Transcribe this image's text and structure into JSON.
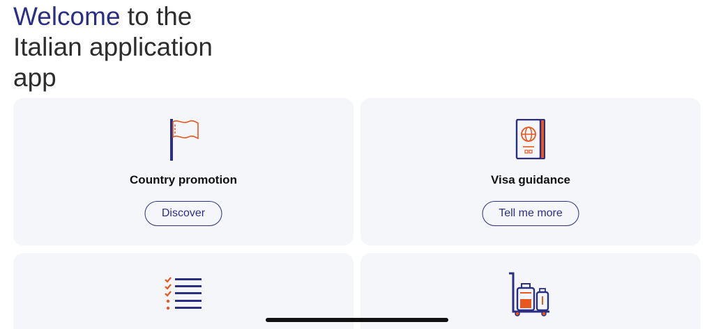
{
  "header": {
    "title_accent": "Welcome",
    "title_rest": " to the Italian application app"
  },
  "cards": [
    {
      "icon": "flag-icon",
      "title": "Country promotion",
      "button_label": "Discover"
    },
    {
      "icon": "passport-icon",
      "title": "Visa guidance",
      "button_label": "Tell me more"
    },
    {
      "icon": "checklist-icon",
      "title": "",
      "button_label": ""
    },
    {
      "icon": "luggage-trolley-icon",
      "title": "",
      "button_label": ""
    }
  ],
  "colors": {
    "accent": "#2b2f84",
    "icon_orange": "#e8571e",
    "card_background": "#f5f6fa"
  }
}
